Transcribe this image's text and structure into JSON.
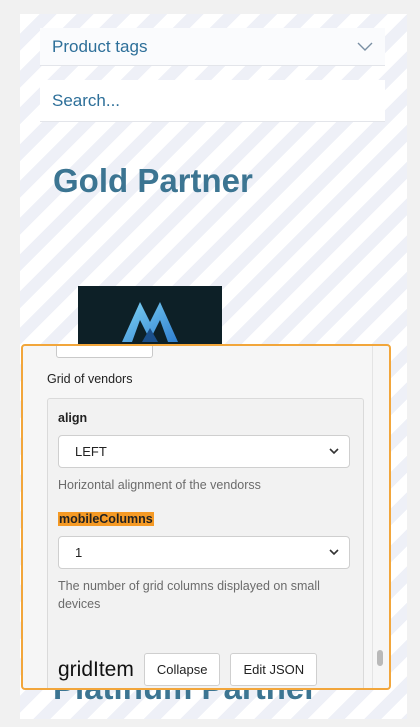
{
  "product_tags": {
    "label": "Product tags",
    "icon": "chevron-down-icon"
  },
  "search": {
    "placeholder": "Search..."
  },
  "sections": {
    "gold_title": "Gold Partner",
    "platinum_title": "Platinum Partner"
  },
  "editor": {
    "group_title": "Grid of vendors",
    "align": {
      "name": "align",
      "value": "LEFT",
      "description": "Horizontal alignment of the vendorss"
    },
    "mobile_columns": {
      "name": "mobileColumns",
      "value": "1",
      "description": "The number of grid columns displayed on small devices"
    },
    "grid_item": {
      "label": "gridItem",
      "collapse_label": "Collapse",
      "edit_json_label": "Edit JSON"
    }
  },
  "colors": {
    "accent_link": "#2d6f99",
    "title": "#3c7592",
    "editor_border": "#f2a63b",
    "highlight": "#f59a25"
  }
}
